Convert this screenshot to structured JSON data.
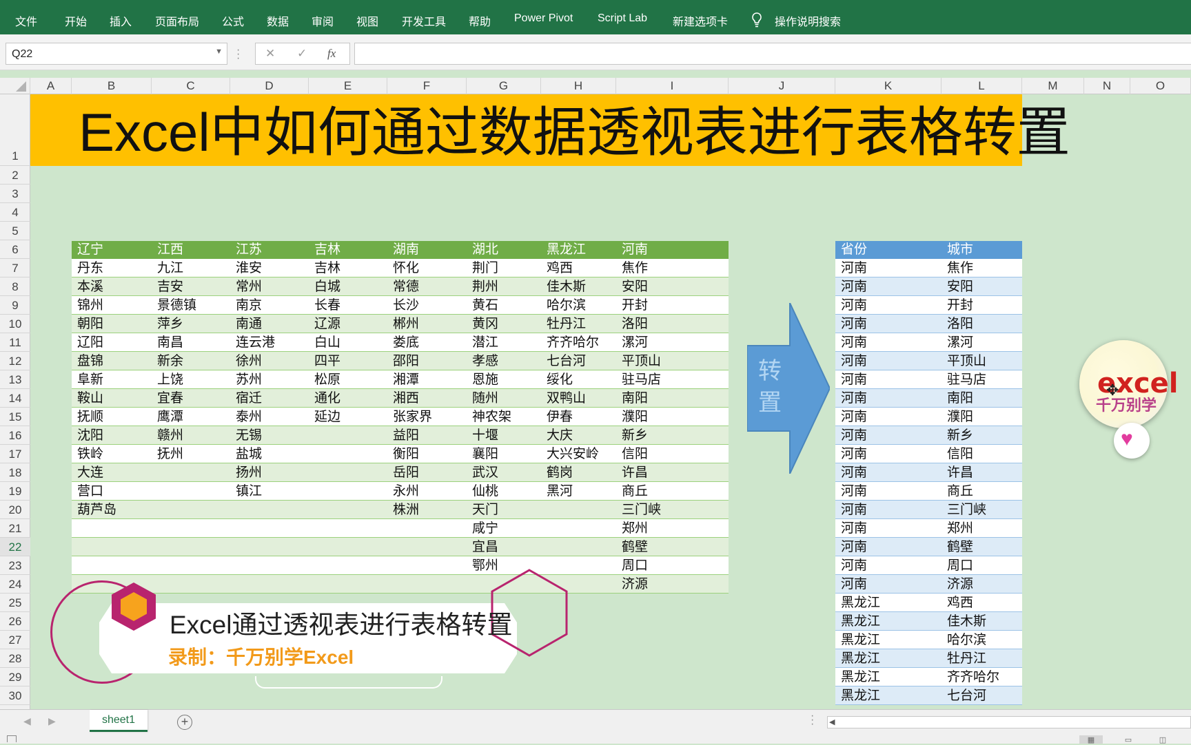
{
  "ribbon": {
    "tabs": [
      "文件",
      "开始",
      "插入",
      "页面布局",
      "公式",
      "数据",
      "审阅",
      "视图",
      "开发工具",
      "帮助",
      "Power Pivot",
      "Script Lab",
      "新建选项卡"
    ],
    "search": "操作说明搜索"
  },
  "formula_bar": {
    "name_box": "Q22",
    "fx": "fx",
    "cancel": "✕",
    "confirm": "✓",
    "value": ""
  },
  "columns": [
    "A",
    "B",
    "C",
    "D",
    "E",
    "F",
    "G",
    "H",
    "I",
    "J",
    "K",
    "L",
    "M",
    "N",
    "O"
  ],
  "rows": [
    "1",
    "2",
    "3",
    "4",
    "5",
    "6",
    "7",
    "8",
    "9",
    "10",
    "11",
    "12",
    "13",
    "14",
    "15",
    "16",
    "17",
    "18",
    "19",
    "20",
    "21",
    "22",
    "23",
    "24",
    "25",
    "26",
    "27",
    "28",
    "29",
    "30"
  ],
  "title": "Excel中如何通过数据透视表进行表格转置",
  "source_table": {
    "headers": [
      "辽宁",
      "江西",
      "江苏",
      "吉林",
      "湖南",
      "湖北",
      "黑龙江",
      "河南"
    ],
    "rows": [
      [
        "丹东",
        "九江",
        "淮安",
        "吉林",
        "怀化",
        "荆门",
        "鸡西",
        "焦作"
      ],
      [
        "本溪",
        "吉安",
        "常州",
        "白城",
        "常德",
        "荆州",
        "佳木斯",
        "安阳"
      ],
      [
        "锦州",
        "景德镇",
        "南京",
        "长春",
        "长沙",
        "黄石",
        "哈尔滨",
        "开封"
      ],
      [
        "朝阳",
        "萍乡",
        "南通",
        "辽源",
        "郴州",
        "黄冈",
        "牡丹江",
        "洛阳"
      ],
      [
        "辽阳",
        "南昌",
        "连云港",
        "白山",
        "娄底",
        "潜江",
        "齐齐哈尔",
        "漯河"
      ],
      [
        "盘锦",
        "新余",
        "徐州",
        "四平",
        "邵阳",
        "孝感",
        "七台河",
        "平顶山"
      ],
      [
        "阜新",
        "上饶",
        "苏州",
        "松原",
        "湘潭",
        "恩施",
        "绥化",
        "驻马店"
      ],
      [
        "鞍山",
        "宜春",
        "宿迁",
        "通化",
        "湘西",
        "随州",
        "双鸭山",
        "南阳"
      ],
      [
        "抚顺",
        "鹰潭",
        "泰州",
        "延边",
        "张家界",
        "神农架",
        "伊春",
        "濮阳"
      ],
      [
        "沈阳",
        "赣州",
        "无锡",
        "",
        "益阳",
        "十堰",
        "大庆",
        "新乡"
      ],
      [
        "铁岭",
        "抚州",
        "盐城",
        "",
        "衡阳",
        "襄阳",
        "大兴安岭",
        "信阳"
      ],
      [
        "大连",
        "",
        "扬州",
        "",
        "岳阳",
        "武汉",
        "鹤岗",
        "许昌"
      ],
      [
        "营口",
        "",
        "镇江",
        "",
        "永州",
        "仙桃",
        "黑河",
        "商丘"
      ],
      [
        "葫芦岛",
        "",
        "",
        "",
        "株洲",
        "天门",
        "",
        "三门峡"
      ],
      [
        "",
        "",
        "",
        "",
        "",
        "咸宁",
        "",
        "郑州"
      ],
      [
        "",
        "",
        "",
        "",
        "",
        "宜昌",
        "",
        "鹤壁"
      ],
      [
        "",
        "",
        "",
        "",
        "",
        "鄂州",
        "",
        "周口"
      ],
      [
        "",
        "",
        "",
        "",
        "",
        "",
        "",
        "济源"
      ]
    ]
  },
  "arrow_label": "转置",
  "result_table": {
    "headers": [
      "省份",
      "城市"
    ],
    "rows": [
      [
        "河南",
        "焦作"
      ],
      [
        "河南",
        "安阳"
      ],
      [
        "河南",
        "开封"
      ],
      [
        "河南",
        "洛阳"
      ],
      [
        "河南",
        "漯河"
      ],
      [
        "河南",
        "平顶山"
      ],
      [
        "河南",
        "驻马店"
      ],
      [
        "河南",
        "南阳"
      ],
      [
        "河南",
        "濮阳"
      ],
      [
        "河南",
        "新乡"
      ],
      [
        "河南",
        "信阳"
      ],
      [
        "河南",
        "许昌"
      ],
      [
        "河南",
        "商丘"
      ],
      [
        "河南",
        "三门峡"
      ],
      [
        "河南",
        "郑州"
      ],
      [
        "河南",
        "鹤壁"
      ],
      [
        "河南",
        "周口"
      ],
      [
        "河南",
        "济源"
      ],
      [
        "黑龙江",
        "鸡西"
      ],
      [
        "黑龙江",
        "佳木斯"
      ],
      [
        "黑龙江",
        "哈尔滨"
      ],
      [
        "黑龙江",
        "牡丹江"
      ],
      [
        "黑龙江",
        "齐齐哈尔"
      ],
      [
        "黑龙江",
        "七台河"
      ]
    ]
  },
  "logo": {
    "text": "excel",
    "subtitle": "千万别学"
  },
  "watermark": {
    "title": "Excel通过透视表进行表格转置",
    "subtitle": "录制：千万别学Excel"
  },
  "sheet_tab": "sheet1",
  "add_sheet": "+",
  "colors": {
    "ribbon": "#217346",
    "title_band": "#ffc000",
    "source_header": "#70ad47",
    "result_header": "#5b9bd5",
    "arrow": "#5b9bd5",
    "sheet_bg": "#cee6cc"
  }
}
